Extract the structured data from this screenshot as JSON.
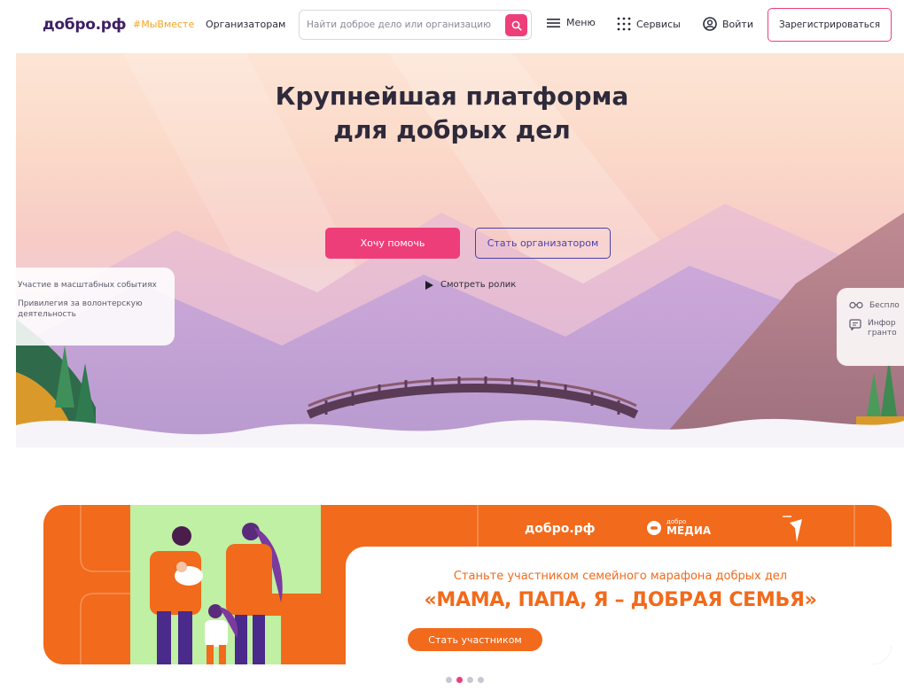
{
  "header": {
    "logo": "добро.рф",
    "hashtag": "#МыВместе",
    "organizers_link": "Организаторам",
    "search_placeholder": "Найти доброе дело или организацию",
    "menu_label": "Меню",
    "services_label": "Сервисы",
    "login_label": "Войти",
    "register_label": "Зарегистрироваться"
  },
  "hero": {
    "title_line1": "Крупнейшая платформа",
    "title_line2": "для добрых дел",
    "help_button": "Хочу помочь",
    "organizer_button": "Стать организатором",
    "video_link": "Смотреть ролик",
    "left_card": {
      "item1": "Участие в масштабных событиях",
      "item2": "Привилегия за волонтерскую деятельность"
    },
    "right_card": {
      "item1": "Беспло",
      "item2_line1": "Инфор",
      "item2_line2": "гранто"
    }
  },
  "banner": {
    "logo": "добро.рф",
    "media_small": "добро",
    "media_big": "МЕДИА",
    "subtitle": "Станьте участником семейного марафона добрых дел",
    "title": "«МАМА, ПАПА, Я – ДОБРАЯ СЕМЬЯ»",
    "cta": "Стать участником"
  },
  "carousel": {
    "count": 4,
    "active": 1
  },
  "colors": {
    "brand_pink": "#ee3e7a",
    "brand_purple": "#3d1f64",
    "accent_yellow": "#f5a623",
    "banner_orange": "#f26a1b",
    "banner_green": "#bff0a3"
  },
  "icons": {
    "search": "search-icon",
    "menu": "hamburger-icon",
    "services": "grid-dots-icon",
    "login": "user-circle-icon",
    "play": "play-icon",
    "glasses": "glasses-icon",
    "document": "document-icon"
  }
}
